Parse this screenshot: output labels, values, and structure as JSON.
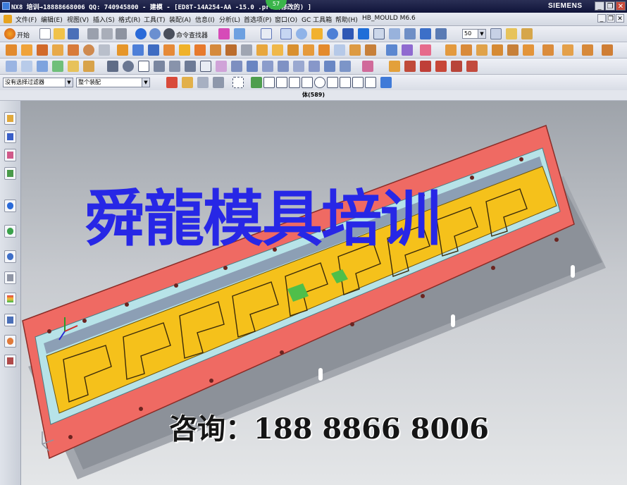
{
  "window": {
    "title": "NX8 培训→18888668006 QQ: 740945800 - 建模 - [ED8T-14A254-AA -15.0 .prt  (修改的) ]",
    "brand": "SIEMENS",
    "badge": "57",
    "controls": {
      "minimize": "_",
      "restore": "❐",
      "close": "✕"
    }
  },
  "menu": {
    "items": [
      "文件(F)",
      "编辑(E)",
      "视图(V)",
      "插入(S)",
      "格式(R)",
      "工具(T)",
      "装配(A)",
      "信息(I)",
      "分析(L)",
      "首选项(P)",
      "窗口(O)",
      "GC 工具箱",
      "帮助(H)",
      "HB_MOULD M6.6"
    ],
    "window_controls": [
      "_",
      "❐",
      "✕"
    ]
  },
  "toolbar": {
    "start_label": "开始",
    "command_finder": "命令查找器",
    "zoom_value": "50"
  },
  "selection": {
    "filter": "没有选择过滤器",
    "scope": "整个装配"
  },
  "selection_info": "体(589)",
  "resource_bar": {
    "icons": [
      "assembly-navigator-icon",
      "constraint-navigator-icon",
      "part-navigator-icon",
      "reuse-library-icon",
      "hd3d-tools-icon",
      "web-browser-icon",
      "history-icon",
      "system-materials-icon",
      "process-studio-icon",
      "manufacturing-wizards-icon",
      "roles-icon",
      "system-scenes-icon"
    ]
  },
  "viewport": {
    "watermark": "舜龍模具培训",
    "contact": "咨询：188 8866 8006",
    "colors": {
      "plate_red": "#ef6a63",
      "plate_cyan": "#b7e3e8",
      "insert_yellow": "#f5c11b",
      "watermark_blue": "#2727e6"
    }
  }
}
